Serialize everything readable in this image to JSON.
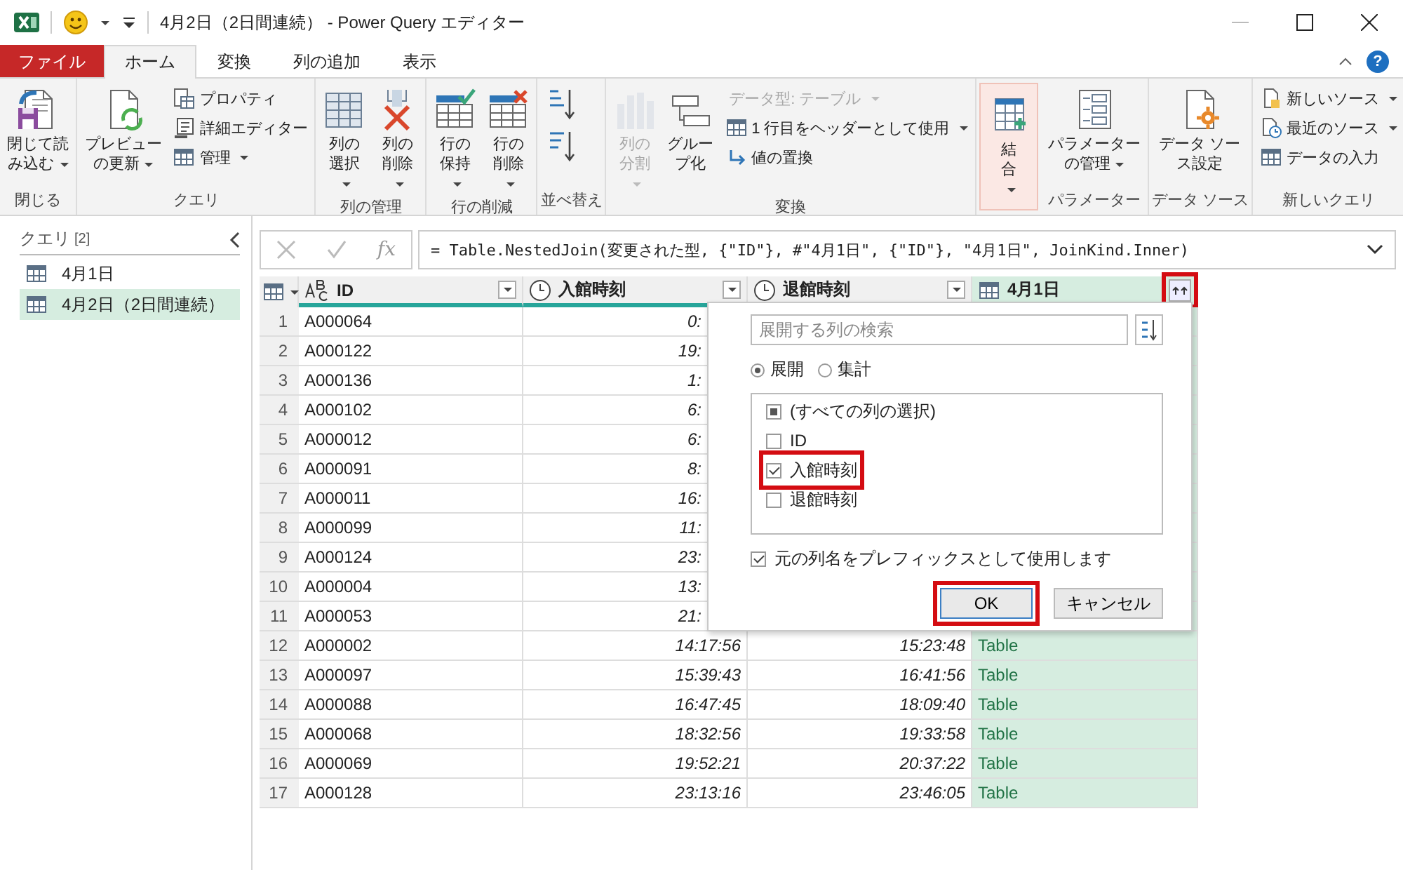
{
  "window": {
    "title": "4月2日（2日間連続） - Power Query エディター",
    "quick_access_dropdown": true
  },
  "ribbon_tabs": [
    {
      "label": "ファイル",
      "kind": "file",
      "selected": false
    },
    {
      "label": "ホーム",
      "kind": "tab",
      "selected": true
    },
    {
      "label": "変換",
      "kind": "tab",
      "selected": false
    },
    {
      "label": "列の追加",
      "kind": "tab",
      "selected": false
    },
    {
      "label": "表示",
      "kind": "tab",
      "selected": false
    }
  ],
  "help": "?",
  "ribbon_groups": [
    {
      "label": "閉じる",
      "hovered": false,
      "items": [
        {
          "kind": "large",
          "label": "閉じて読み込む",
          "dropdown": true,
          "disabled": false
        }
      ]
    },
    {
      "label": "クエリ",
      "hovered": false,
      "items": [
        {
          "kind": "large",
          "label": "プレビューの更新",
          "dropdown": true,
          "disabled": false
        },
        {
          "kind": "small",
          "label": "プロパティ",
          "dropdown": false,
          "disabled": false
        },
        {
          "kind": "small",
          "label": "詳細エディター",
          "dropdown": false,
          "disabled": false
        },
        {
          "kind": "small",
          "label": "管理",
          "dropdown": true,
          "disabled": false
        }
      ]
    },
    {
      "label": "列の管理",
      "hovered": false,
      "items": [
        {
          "kind": "large",
          "label": "列の選択",
          "dropdown": true,
          "disabled": false
        },
        {
          "kind": "large",
          "label": "列の削除",
          "dropdown": true,
          "disabled": false
        }
      ]
    },
    {
      "label": "行の削減",
      "hovered": false,
      "items": [
        {
          "kind": "large",
          "label": "行の保持",
          "dropdown": true,
          "disabled": false
        },
        {
          "kind": "large",
          "label": "行の削除",
          "dropdown": true,
          "disabled": false
        }
      ]
    },
    {
      "label": "並べ替え",
      "hovered": false,
      "items": [
        {
          "kind": "icon",
          "disabled": false
        },
        {
          "kind": "icon",
          "disabled": false
        }
      ]
    },
    {
      "label": "変換",
      "hovered": false,
      "items": [
        {
          "kind": "large",
          "label": "列の分割",
          "dropdown": true,
          "disabled": true
        },
        {
          "kind": "large",
          "label": "グループ化",
          "dropdown": false,
          "disabled": false
        },
        {
          "kind": "small",
          "label": "データ型: テーブル",
          "dropdown": true,
          "disabled": true
        },
        {
          "kind": "small",
          "label": "1 行目をヘッダーとして使用",
          "dropdown": true,
          "disabled": false
        },
        {
          "kind": "small",
          "label": "値の置換",
          "dropdown": false,
          "disabled": false
        }
      ]
    },
    {
      "hovered": true,
      "items": [
        {
          "kind": "large",
          "label": "結合",
          "dropdown": true,
          "disabled": false
        }
      ]
    },
    {
      "label": "パラメーター",
      "hovered": false,
      "items": [
        {
          "kind": "large",
          "label": "パラメーターの管理",
          "dropdown": true,
          "disabled": false
        }
      ]
    },
    {
      "label": "データ ソース",
      "hovered": false,
      "items": [
        {
          "kind": "large",
          "label": "データ ソース設定",
          "dropdown": false,
          "disabled": false
        }
      ]
    },
    {
      "label": "新しいクエリ",
      "hovered": false,
      "items": [
        {
          "kind": "small",
          "label": "新しいソース",
          "dropdown": true,
          "disabled": false
        },
        {
          "kind": "small",
          "label": "最近のソース",
          "dropdown": true,
          "disabled": false
        },
        {
          "kind": "small",
          "label": "データの入力",
          "dropdown": false,
          "disabled": false
        }
      ]
    }
  ],
  "queries": {
    "title": "クエリ",
    "count": "[2]",
    "items": [
      {
        "label": "4月1日",
        "selected": false
      },
      {
        "label": "4月2日（2日間連続）",
        "selected": true
      }
    ]
  },
  "formula_bar": {
    "fx": "fx",
    "formula": "= Table.NestedJoin(変更された型, {\"ID\"}, #\"4月1日\", {\"ID\"}, \"4月1日\", JoinKind.Inner)"
  },
  "table": {
    "columns": [
      {
        "label": "ID",
        "kind": "text",
        "highlighted": false
      },
      {
        "label": "入館時刻",
        "kind": "time",
        "highlighted": false
      },
      {
        "label": "退館時刻",
        "kind": "time",
        "highlighted": false
      },
      {
        "label": "4月1日",
        "kind": "table",
        "highlighted": true
      }
    ],
    "rows": [
      {
        "num": "1",
        "cells": [
          "A000064",
          "0:"
        ]
      },
      {
        "num": "2",
        "cells": [
          "A000122",
          "19:"
        ]
      },
      {
        "num": "3",
        "cells": [
          "A000136",
          "1:"
        ]
      },
      {
        "num": "4",
        "cells": [
          "A000102",
          "6:"
        ]
      },
      {
        "num": "5",
        "cells": [
          "A000012",
          "6:"
        ]
      },
      {
        "num": "6",
        "cells": [
          "A000091",
          "8:"
        ]
      },
      {
        "num": "7",
        "cells": [
          "A000011",
          "16:"
        ]
      },
      {
        "num": "8",
        "cells": [
          "A000099",
          "11:"
        ]
      },
      {
        "num": "9",
        "cells": [
          "A000124",
          "23:"
        ]
      },
      {
        "num": "10",
        "cells": [
          "A000004",
          "13:"
        ]
      },
      {
        "num": "11",
        "cells": [
          "A000053",
          "21:"
        ]
      },
      {
        "num": "12",
        "cells": [
          "A000002",
          "14:17:56",
          "15:23:48",
          "Table"
        ]
      },
      {
        "num": "13",
        "cells": [
          "A000097",
          "15:39:43",
          "16:41:56",
          "Table"
        ]
      },
      {
        "num": "14",
        "cells": [
          "A000088",
          "16:47:45",
          "18:09:40",
          "Table"
        ]
      },
      {
        "num": "15",
        "cells": [
          "A000068",
          "18:32:56",
          "19:33:58",
          "Table"
        ]
      },
      {
        "num": "16",
        "cells": [
          "A000069",
          "19:52:21",
          "20:37:22",
          "Table"
        ]
      },
      {
        "num": "17",
        "cells": [
          "A000128",
          "23:13:16",
          "23:46:05",
          "Table"
        ]
      }
    ]
  },
  "expand_dialog": {
    "search": {
      "placeholder": "展開する列の検索"
    },
    "modes": [
      {
        "label": "展開",
        "selected": true
      },
      {
        "label": "集計",
        "selected": false
      }
    ],
    "columns": [
      {
        "label": "(すべての列の選択)",
        "checked": false,
        "mixed": true,
        "highlighted": false
      },
      {
        "label": "ID",
        "checked": false,
        "mixed": false,
        "highlighted": false
      },
      {
        "label": "入館時刻",
        "checked": true,
        "mixed": false,
        "highlighted": true
      },
      {
        "label": "退館時刻",
        "checked": false,
        "mixed": false,
        "highlighted": false
      }
    ],
    "prefix": {
      "label": "元の列名をプレフィックスとして使用します",
      "checked": true
    },
    "buttons": [
      {
        "label": "OK",
        "kind": "default",
        "highlighted": true
      },
      {
        "label": "キャンセル",
        "kind": "normal",
        "highlighted": false
      }
    ]
  }
}
